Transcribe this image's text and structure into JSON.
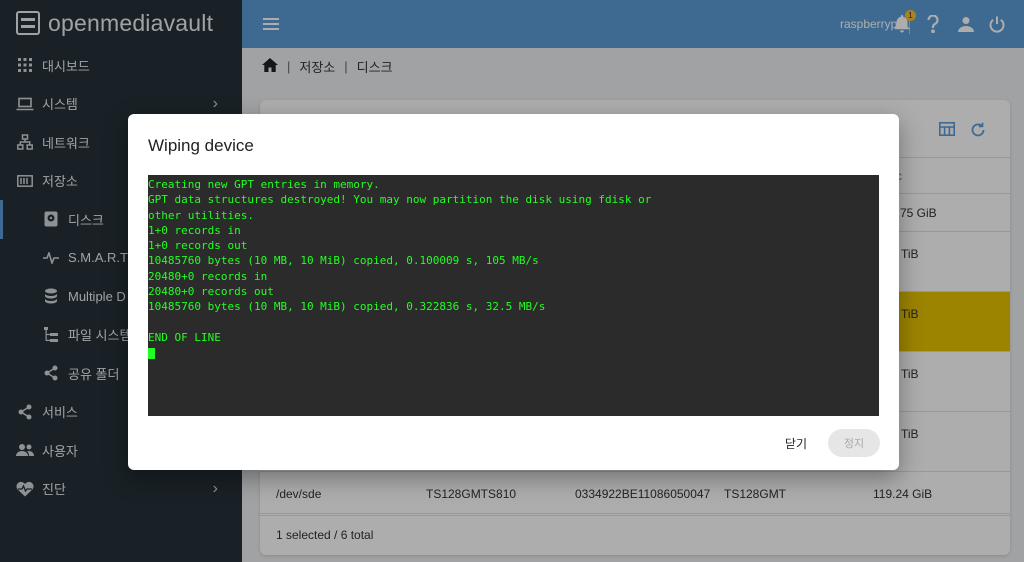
{
  "brand": {
    "name": "openmediavault"
  },
  "sidebar": {
    "items": [
      {
        "label": "대시보드",
        "icon": "dashboard-grid-icon"
      },
      {
        "label": "시스템",
        "icon": "laptop-icon"
      },
      {
        "label": "네트워크",
        "icon": "network-icon"
      },
      {
        "label": "저장소",
        "icon": "storage-icon"
      },
      {
        "label": "디스크",
        "icon": "disk-icon"
      },
      {
        "label": "S.M.A.R.T",
        "icon": "pulse-icon"
      },
      {
        "label": "Multiple D",
        "icon": "database-icon"
      },
      {
        "label": "파일 시스템",
        "icon": "file-tree-icon"
      },
      {
        "label": "공유 폴더",
        "icon": "share-icon"
      },
      {
        "label": "서비스",
        "icon": "share-icon"
      },
      {
        "label": "사용자",
        "icon": "users-icon"
      },
      {
        "label": "진단",
        "icon": "heart-pulse-icon"
      }
    ]
  },
  "topbar": {
    "hostname": "raspberrypi",
    "notification_count": "1"
  },
  "breadcrumb": {
    "items": [
      "저장소",
      "디스크"
    ]
  },
  "table": {
    "header_partial": "c",
    "rows": [
      {
        "capacity": "75 GiB"
      },
      {
        "capacity": "TiB"
      },
      {
        "capacity": "TiB"
      },
      {
        "capacity": "TiB"
      },
      {
        "capacity": "TiB"
      },
      {
        "device": "/dev/sde",
        "model": "TS128GMTS810",
        "serial": "0334922BE11086050047",
        "vendor": "TS128GMT",
        "capacity": "119.24 GiB"
      }
    ],
    "footer": "1 selected / 6 total"
  },
  "dialog": {
    "title": "Wiping device",
    "terminal_lines": [
      "Creating new GPT entries in memory.",
      "GPT data structures destroyed! You may now partition the disk using fdisk or",
      "other utilities.",
      "1+0 records in",
      "1+0 records out",
      "10485760 bytes (10 MB, 10 MiB) copied, 0.100009 s, 105 MB/s",
      "20480+0 records in",
      "20480+0 records out",
      "10485760 bytes (10 MB, 10 MiB) copied, 0.322836 s, 32.5 MB/s",
      "",
      "END OF LINE"
    ],
    "close_label": "닫기",
    "stop_label": "정지"
  }
}
